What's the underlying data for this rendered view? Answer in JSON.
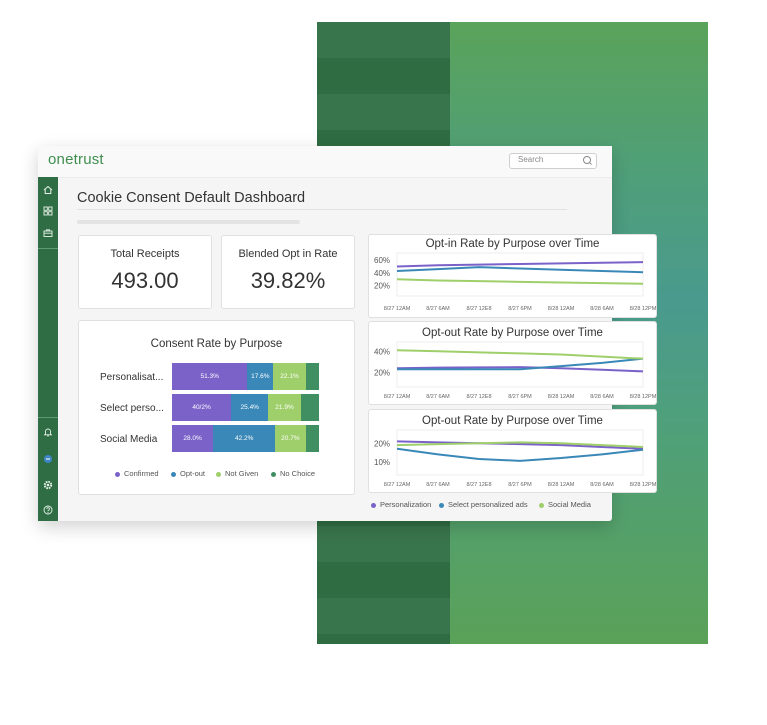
{
  "app": {
    "logo": "onetrust",
    "search_placeholder": "Search"
  },
  "sidebar": {
    "icons": [
      "home-icon",
      "grid-icon",
      "briefcase-icon",
      "bell-icon",
      "badge-icon",
      "gear-icon",
      "help-icon"
    ]
  },
  "page": {
    "title": "Cookie Consent Default Dashboard"
  },
  "kpis": [
    {
      "label": "Total Receipts",
      "value": "493.00"
    },
    {
      "label": "Blended Opt in Rate",
      "value": "39.82%"
    }
  ],
  "colors": {
    "confirmed": "#7b62c9",
    "optout": "#3a88b8",
    "notgiven": "#9fcf6a",
    "nochoice": "#3f8f63",
    "brand": "#3f8e4f"
  },
  "legend_lines": [
    "Personalization",
    "Select personalized ads",
    "Social Media"
  ],
  "chart_data": [
    {
      "type": "bar",
      "title": "Consent Rate by Purpose",
      "categories": [
        "Personalisat...",
        "Select perso...",
        "Social Media"
      ],
      "series": [
        {
          "name": "Confirmed",
          "values": [
            51.3,
            40.2,
            28.0
          ],
          "labels": [
            "51.3%",
            "40/2%",
            "28.0%"
          ]
        },
        {
          "name": "Opt-out",
          "values": [
            17.6,
            25.4,
            42.2
          ],
          "labels": [
            "17.6%",
            "25.4%",
            "42.2%"
          ]
        },
        {
          "name": "Not Given",
          "values": [
            22.1,
            21.9,
            20.7
          ],
          "labels": [
            "22.1%",
            "21.9%",
            "20.7%"
          ]
        },
        {
          "name": "No Choice",
          "values": [
            9.0,
            12.5,
            9.1
          ],
          "labels": [
            "",
            "",
            ""
          ]
        }
      ],
      "legend": "bottom"
    },
    {
      "type": "line",
      "title": "Opt-in Rate by Purpose over Time",
      "x": [
        "8/27 12AM",
        "8/27 6AM",
        "8/27 12E8",
        "8/27 6PM",
        "8/28 12AM",
        "8/28 6AM",
        "8/28 12PM"
      ],
      "yticks": [
        "60%",
        "40%",
        "20%"
      ],
      "ylim": [
        10,
        65
      ],
      "series": [
        {
          "values": [
            50,
            52,
            53,
            54,
            55,
            56,
            57
          ]
        },
        {
          "values": [
            43,
            46,
            49,
            47,
            45,
            43,
            41
          ]
        },
        {
          "values": [
            30,
            28,
            27,
            26,
            25,
            24,
            23
          ]
        }
      ]
    },
    {
      "type": "line",
      "title": "Opt-out Rate by Purpose over Time",
      "x": [
        "8/27 12AM",
        "8/27 6AM",
        "8/27 12E8",
        "8/27 6PM",
        "8/28 12AM",
        "8/28 6AM",
        "8/28 12PM"
      ],
      "yticks": [
        "40%",
        "20%"
      ],
      "ylim": [
        10,
        45
      ],
      "series": [
        {
          "values": [
            24,
            24.5,
            24.8,
            25,
            24,
            22.5,
            21
          ]
        },
        {
          "values": [
            23,
            23,
            23,
            23,
            26,
            29,
            33
          ]
        },
        {
          "values": [
            41,
            40,
            39,
            38,
            37,
            35,
            33
          ]
        }
      ]
    },
    {
      "type": "line",
      "title": "Opt-out Rate by Purpose over Time",
      "x": [
        "8/27 12AM",
        "8/27 6AM",
        "8/27 12E8",
        "8/27 6PM",
        "8/28 12AM",
        "8/28 6AM",
        "8/28 12PM"
      ],
      "yticks": [
        "20%",
        "10%"
      ],
      "ylim": [
        5,
        25
      ],
      "series": [
        {
          "values": [
            21,
            20.5,
            20,
            19.5,
            19,
            18,
            17
          ]
        },
        {
          "values": [
            17,
            14,
            11.5,
            10.5,
            12,
            14,
            16.5
          ]
        },
        {
          "values": [
            19,
            19.5,
            20,
            20.5,
            20,
            19,
            18
          ]
        }
      ]
    }
  ]
}
